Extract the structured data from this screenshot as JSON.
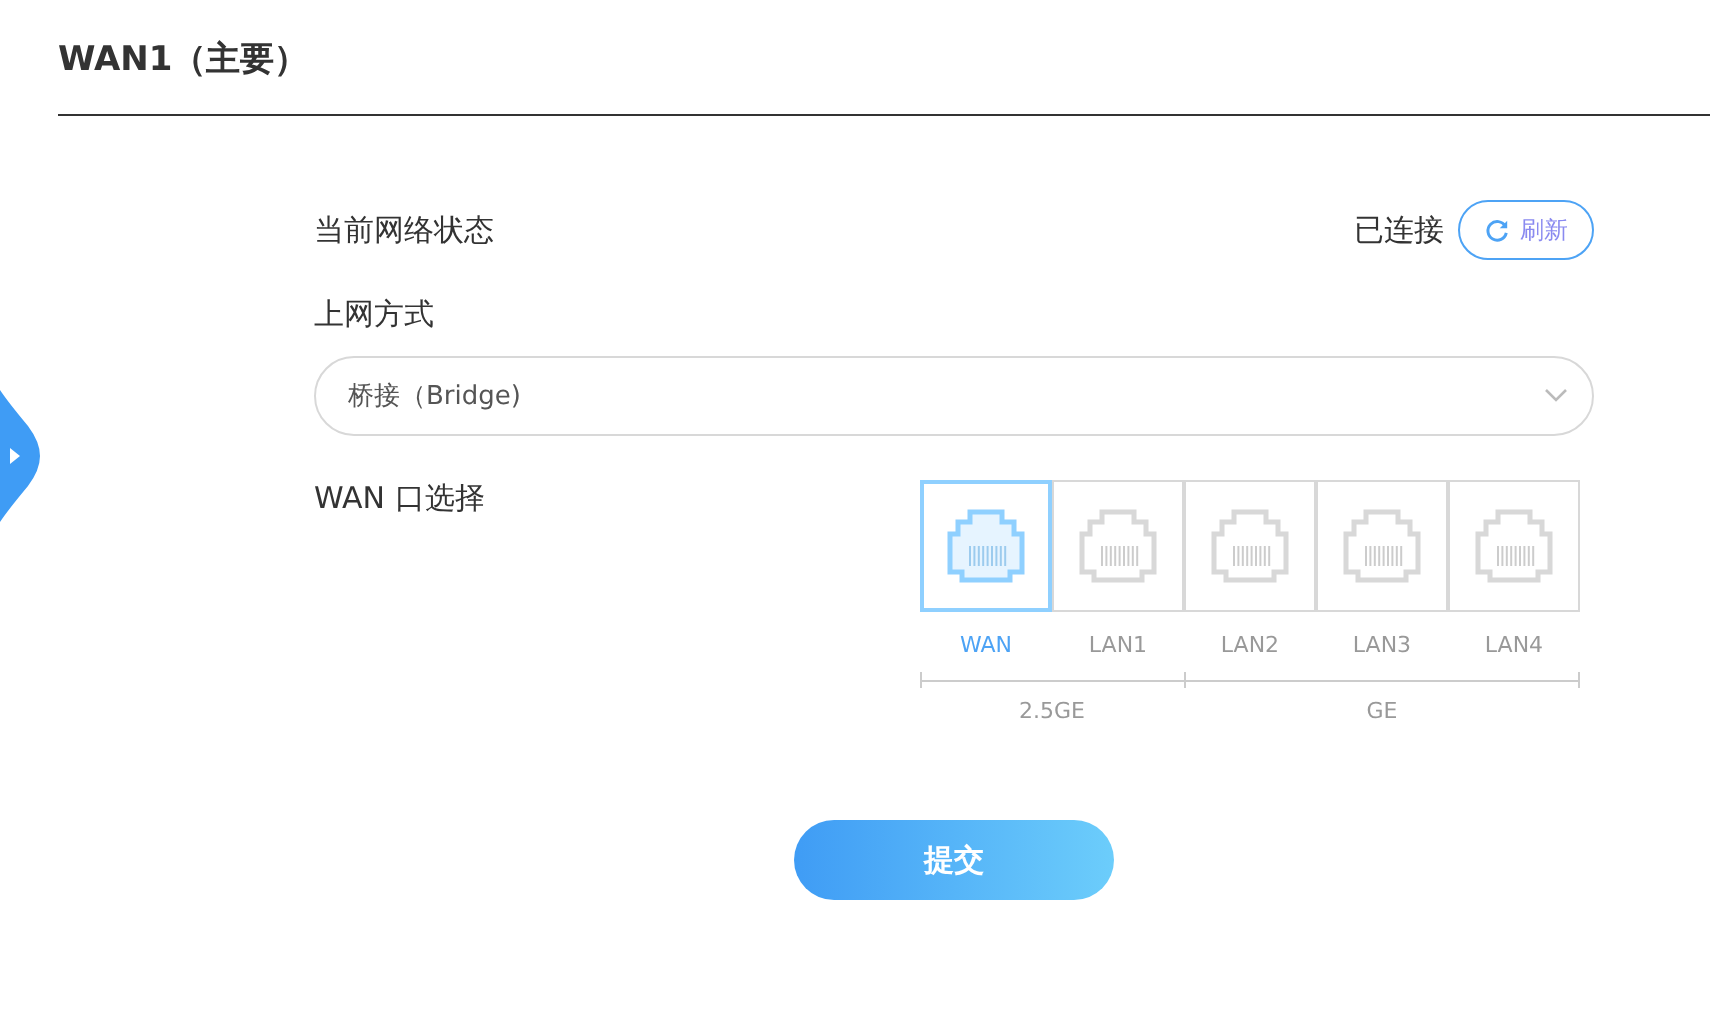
{
  "title": "WAN1（主要）",
  "status": {
    "label": "当前网络状态",
    "value": "已连接",
    "refresh_button": "刷新"
  },
  "mode": {
    "label": "上网方式",
    "value": "桥接（Bridge)"
  },
  "port_select": {
    "label": "WAN 口选择",
    "groups": [
      {
        "label": "2.5GE",
        "ports": [
          {
            "label": "WAN",
            "selected": true
          },
          {
            "label": "LAN1",
            "selected": false
          }
        ]
      },
      {
        "label": "GE",
        "ports": [
          {
            "label": "LAN2",
            "selected": false
          },
          {
            "label": "LAN3",
            "selected": false
          },
          {
            "label": "LAN4",
            "selected": false
          }
        ]
      }
    ]
  },
  "submit_button": "提交"
}
